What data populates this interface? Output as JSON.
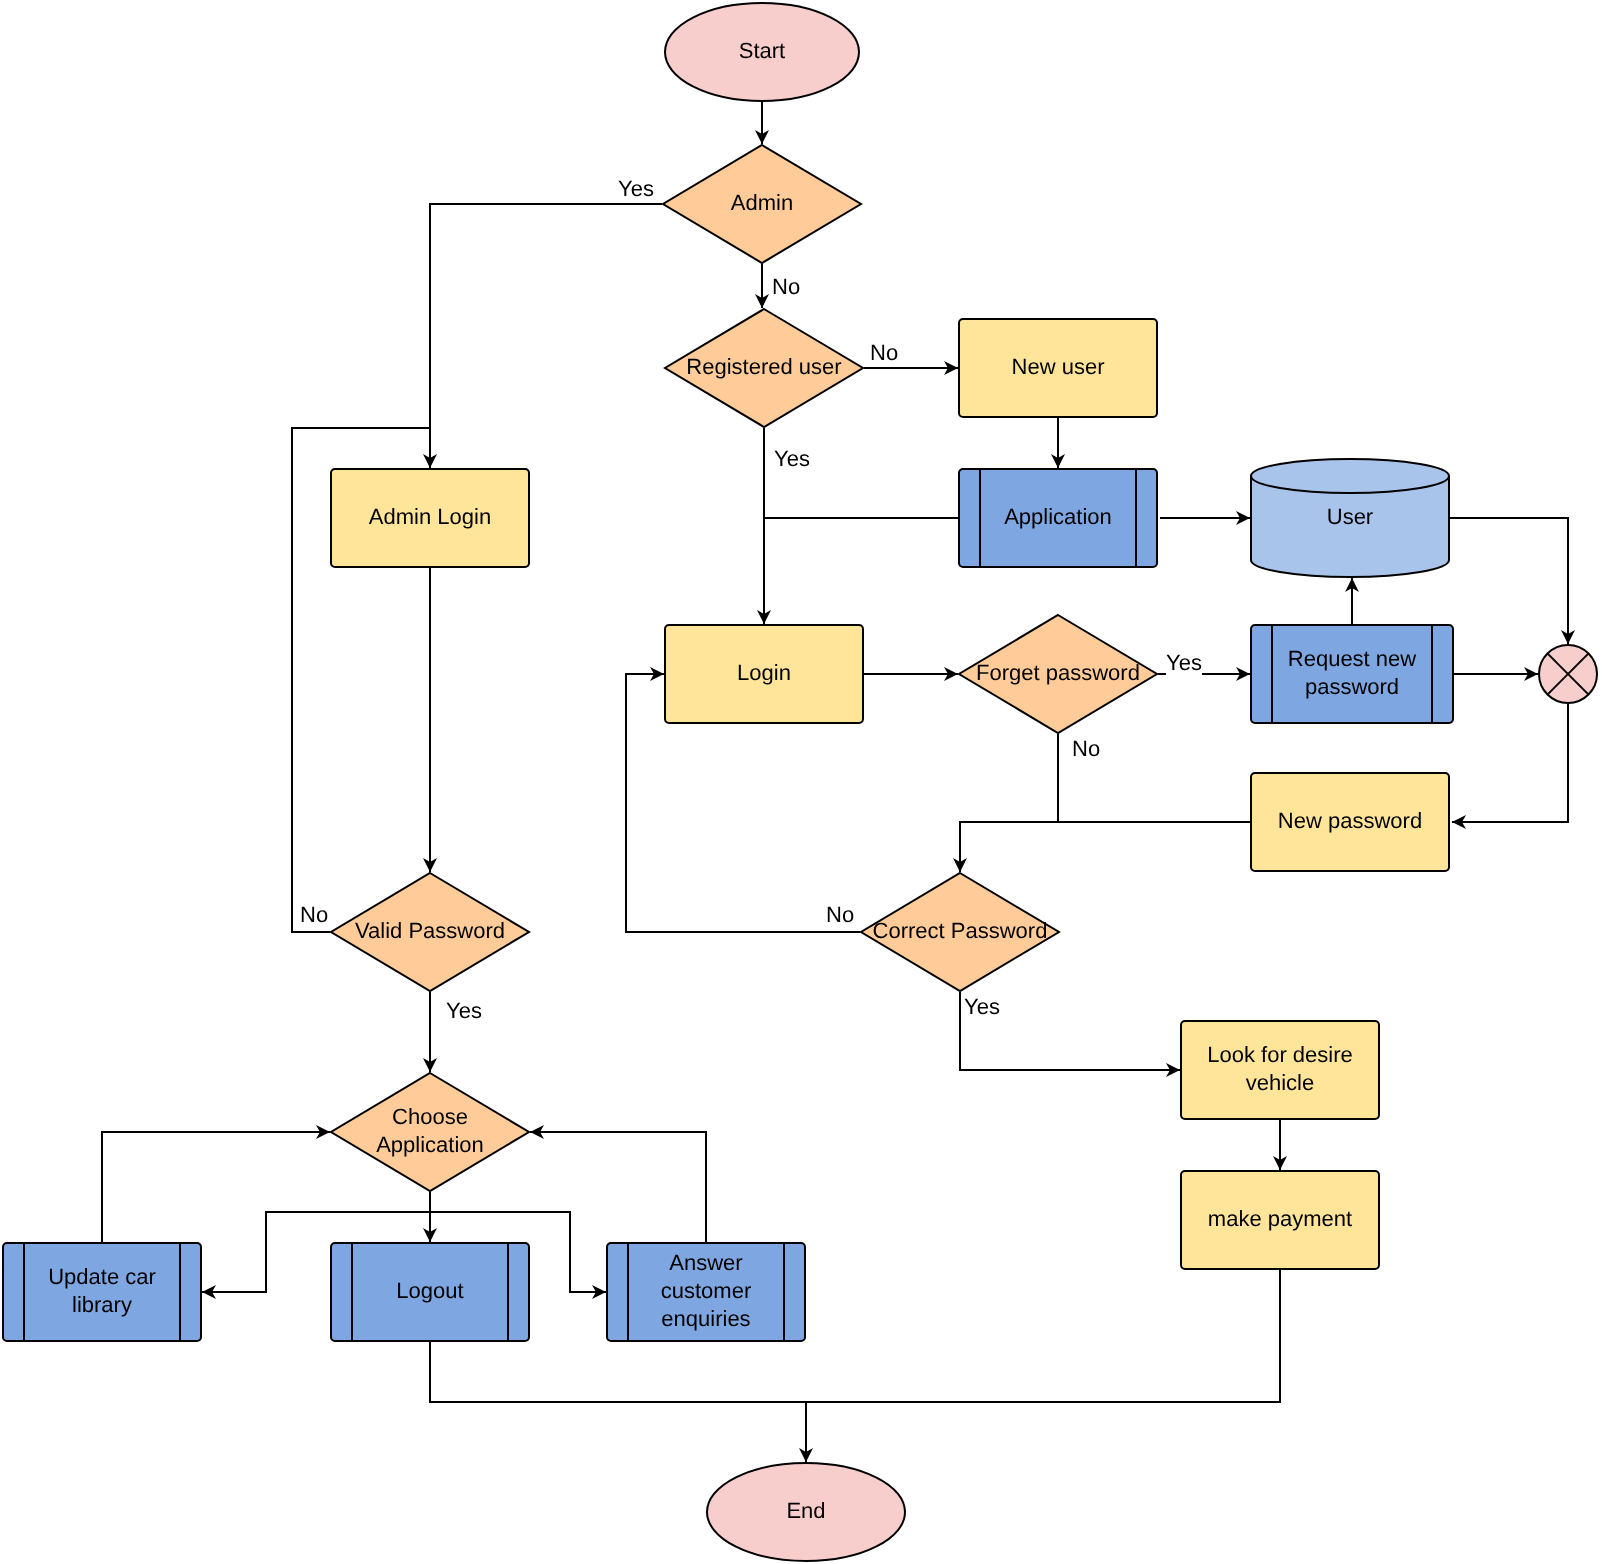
{
  "nodes": [
    {
      "kind": "terminal",
      "label": "Start"
    },
    {
      "kind": "decision",
      "label": "Admin"
    },
    {
      "kind": "decision",
      "label": "Registered user"
    },
    {
      "kind": "process",
      "label": "New user"
    },
    {
      "kind": "process",
      "label": "Admin Login"
    },
    {
      "kind": "subprocess",
      "label": "Application"
    },
    {
      "kind": "database",
      "label": "User"
    },
    {
      "kind": "process",
      "label": "Login"
    },
    {
      "kind": "decision",
      "label": "Forget password"
    },
    {
      "kind": "subprocess",
      "label": "Request new password"
    },
    {
      "kind": "junction"
    },
    {
      "kind": "process",
      "label": "New password"
    },
    {
      "kind": "decision",
      "label": "Valid Password"
    },
    {
      "kind": "decision",
      "label": "Correct Password"
    },
    {
      "kind": "process",
      "label": "Look for desire vehicle"
    },
    {
      "kind": "decision",
      "label": "Choose Application"
    },
    {
      "kind": "process",
      "label": "make payment"
    },
    {
      "kind": "subprocess",
      "label": "Update car library"
    },
    {
      "kind": "subprocess",
      "label": "Logout"
    },
    {
      "kind": "subprocess",
      "label": "Answer customer enquiries"
    },
    {
      "kind": "terminal",
      "label": "End"
    }
  ],
  "edge_labels": [
    "Yes",
    "No",
    "No",
    "Yes",
    "Yes",
    "No",
    "No",
    "No",
    "Yes",
    "Yes"
  ]
}
